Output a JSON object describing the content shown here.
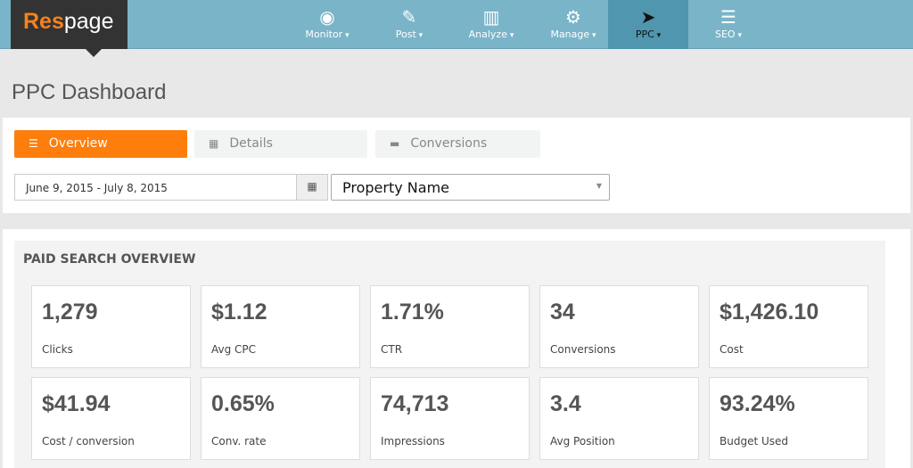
{
  "brand": {
    "part1": "Res",
    "part2": "page"
  },
  "nav": [
    {
      "label": "Monitor",
      "icon": "eye-icon",
      "glyph": "◉"
    },
    {
      "label": "Post",
      "icon": "pencil-icon",
      "glyph": "✎"
    },
    {
      "label": "Analyze",
      "icon": "bar-chart-icon",
      "glyph": "▥"
    },
    {
      "label": "Manage",
      "icon": "gears-icon",
      "glyph": "⚙"
    },
    {
      "label": "PPC",
      "icon": "location-arrow-icon",
      "glyph": "➤",
      "active": true
    },
    {
      "label": "SEO",
      "icon": "ordered-list-icon",
      "glyph": "☰"
    }
  ],
  "page_title": "PPC Dashboard",
  "tabs": [
    {
      "label": "Overview",
      "icon": "list-icon",
      "glyph": "☰"
    },
    {
      "label": "Details",
      "icon": "table-icon",
      "glyph": "▦"
    },
    {
      "label": "Conversions",
      "icon": "briefcase-icon",
      "glyph": "▬"
    }
  ],
  "filters": {
    "date_range": "June 9, 2015 - July 8, 2015",
    "property": "Property Name"
  },
  "overview": {
    "title": "PAID SEARCH OVERVIEW",
    "stats": [
      {
        "value": "1,279",
        "label": "Clicks"
      },
      {
        "value": "$1.12",
        "label": "Avg CPC"
      },
      {
        "value": "1.71%",
        "label": "CTR"
      },
      {
        "value": "34",
        "label": "Conversions"
      },
      {
        "value": "$1,426.10",
        "label": "Cost"
      },
      {
        "value": "$41.94",
        "label": "Cost / conversion"
      },
      {
        "value": "0.65%",
        "label": "Conv. rate"
      },
      {
        "value": "74,713",
        "label": "Impressions"
      },
      {
        "value": "3.4",
        "label": "Avg Position"
      },
      {
        "value": "93.24%",
        "label": "Budget Used"
      }
    ]
  },
  "colors": {
    "nav": "#7ab4c8",
    "nav_active": "#4f96ae",
    "accent": "#fd7e0d",
    "logo_bg": "#333333"
  }
}
